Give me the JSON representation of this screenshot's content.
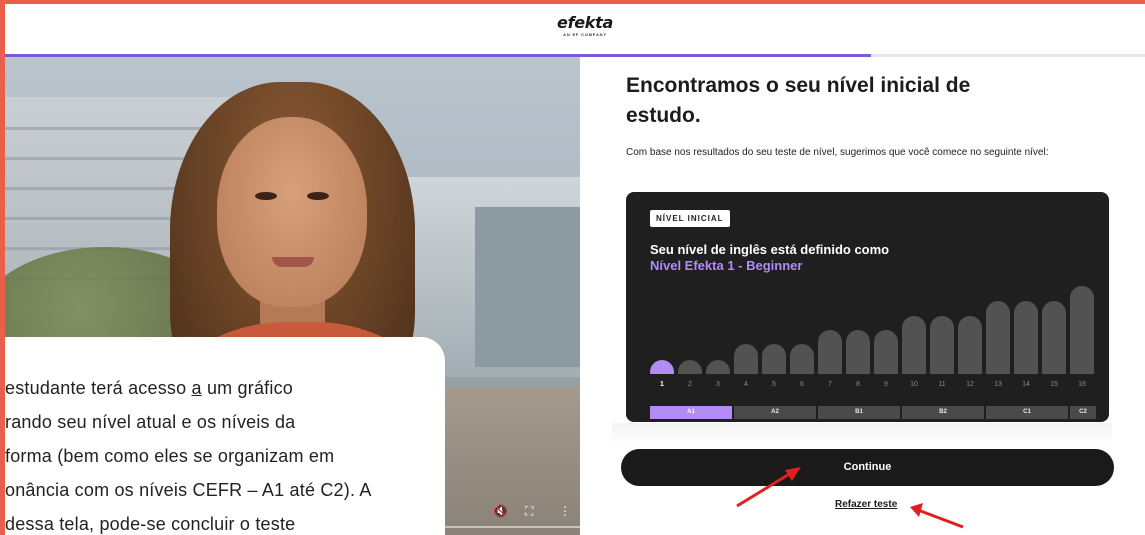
{
  "header": {
    "logo_text": "efekta",
    "logo_sub": "AN EF COMPANY",
    "progress_fraction": 0.76
  },
  "video": {
    "controls": {
      "mute_icon": "volume-muted-icon",
      "fullscreen_icon": "fullscreen-icon",
      "more_icon": "more-vert-icon"
    }
  },
  "caption": {
    "line1_pre": "estudante terá acesso ",
    "line1_link": "a",
    "line1_post": " um gráfico",
    "line2": "rando seu nível atual e os níveis da",
    "line3": "forma (bem como eles se organizam em",
    "line4": "onância com os níveis CEFR – A1 até C2). A",
    "line5": "dessa tela, pode-se concluir o teste"
  },
  "result": {
    "title": "Encontramos o seu nível inicial de estudo.",
    "description": "Com base nos resultados do seu teste de nível, sugerimos que você comece no seguinte nível:",
    "badge": "NÍVEL INICIAL",
    "level_line1": "Seu nível de inglês está definido como",
    "level_line2": "Nível Efekta 1 - Beginner",
    "current_level": 1,
    "levels": [
      "1",
      "2",
      "3",
      "4",
      "5",
      "6",
      "7",
      "8",
      "9",
      "10",
      "11",
      "12",
      "13",
      "14",
      "15",
      "16"
    ],
    "cefr_bands": [
      {
        "label": "A1",
        "from": 1,
        "to": 3,
        "active": true
      },
      {
        "label": "A2",
        "from": 4,
        "to": 6,
        "active": false
      },
      {
        "label": "B1",
        "from": 7,
        "to": 9,
        "active": false
      },
      {
        "label": "B2",
        "from": 10,
        "to": 12,
        "active": false
      },
      {
        "label": "C1",
        "from": 13,
        "to": 15,
        "active": false
      },
      {
        "label": "C2",
        "from": 16,
        "to": 16,
        "active": false
      }
    ]
  },
  "actions": {
    "continue_label": "Continue",
    "retake_label": "Refazer teste"
  },
  "colors": {
    "accent": "#b28bf5",
    "progress": "#7b5cd6",
    "frame": "#e8604a",
    "annotation_arrow": "#e02020"
  }
}
